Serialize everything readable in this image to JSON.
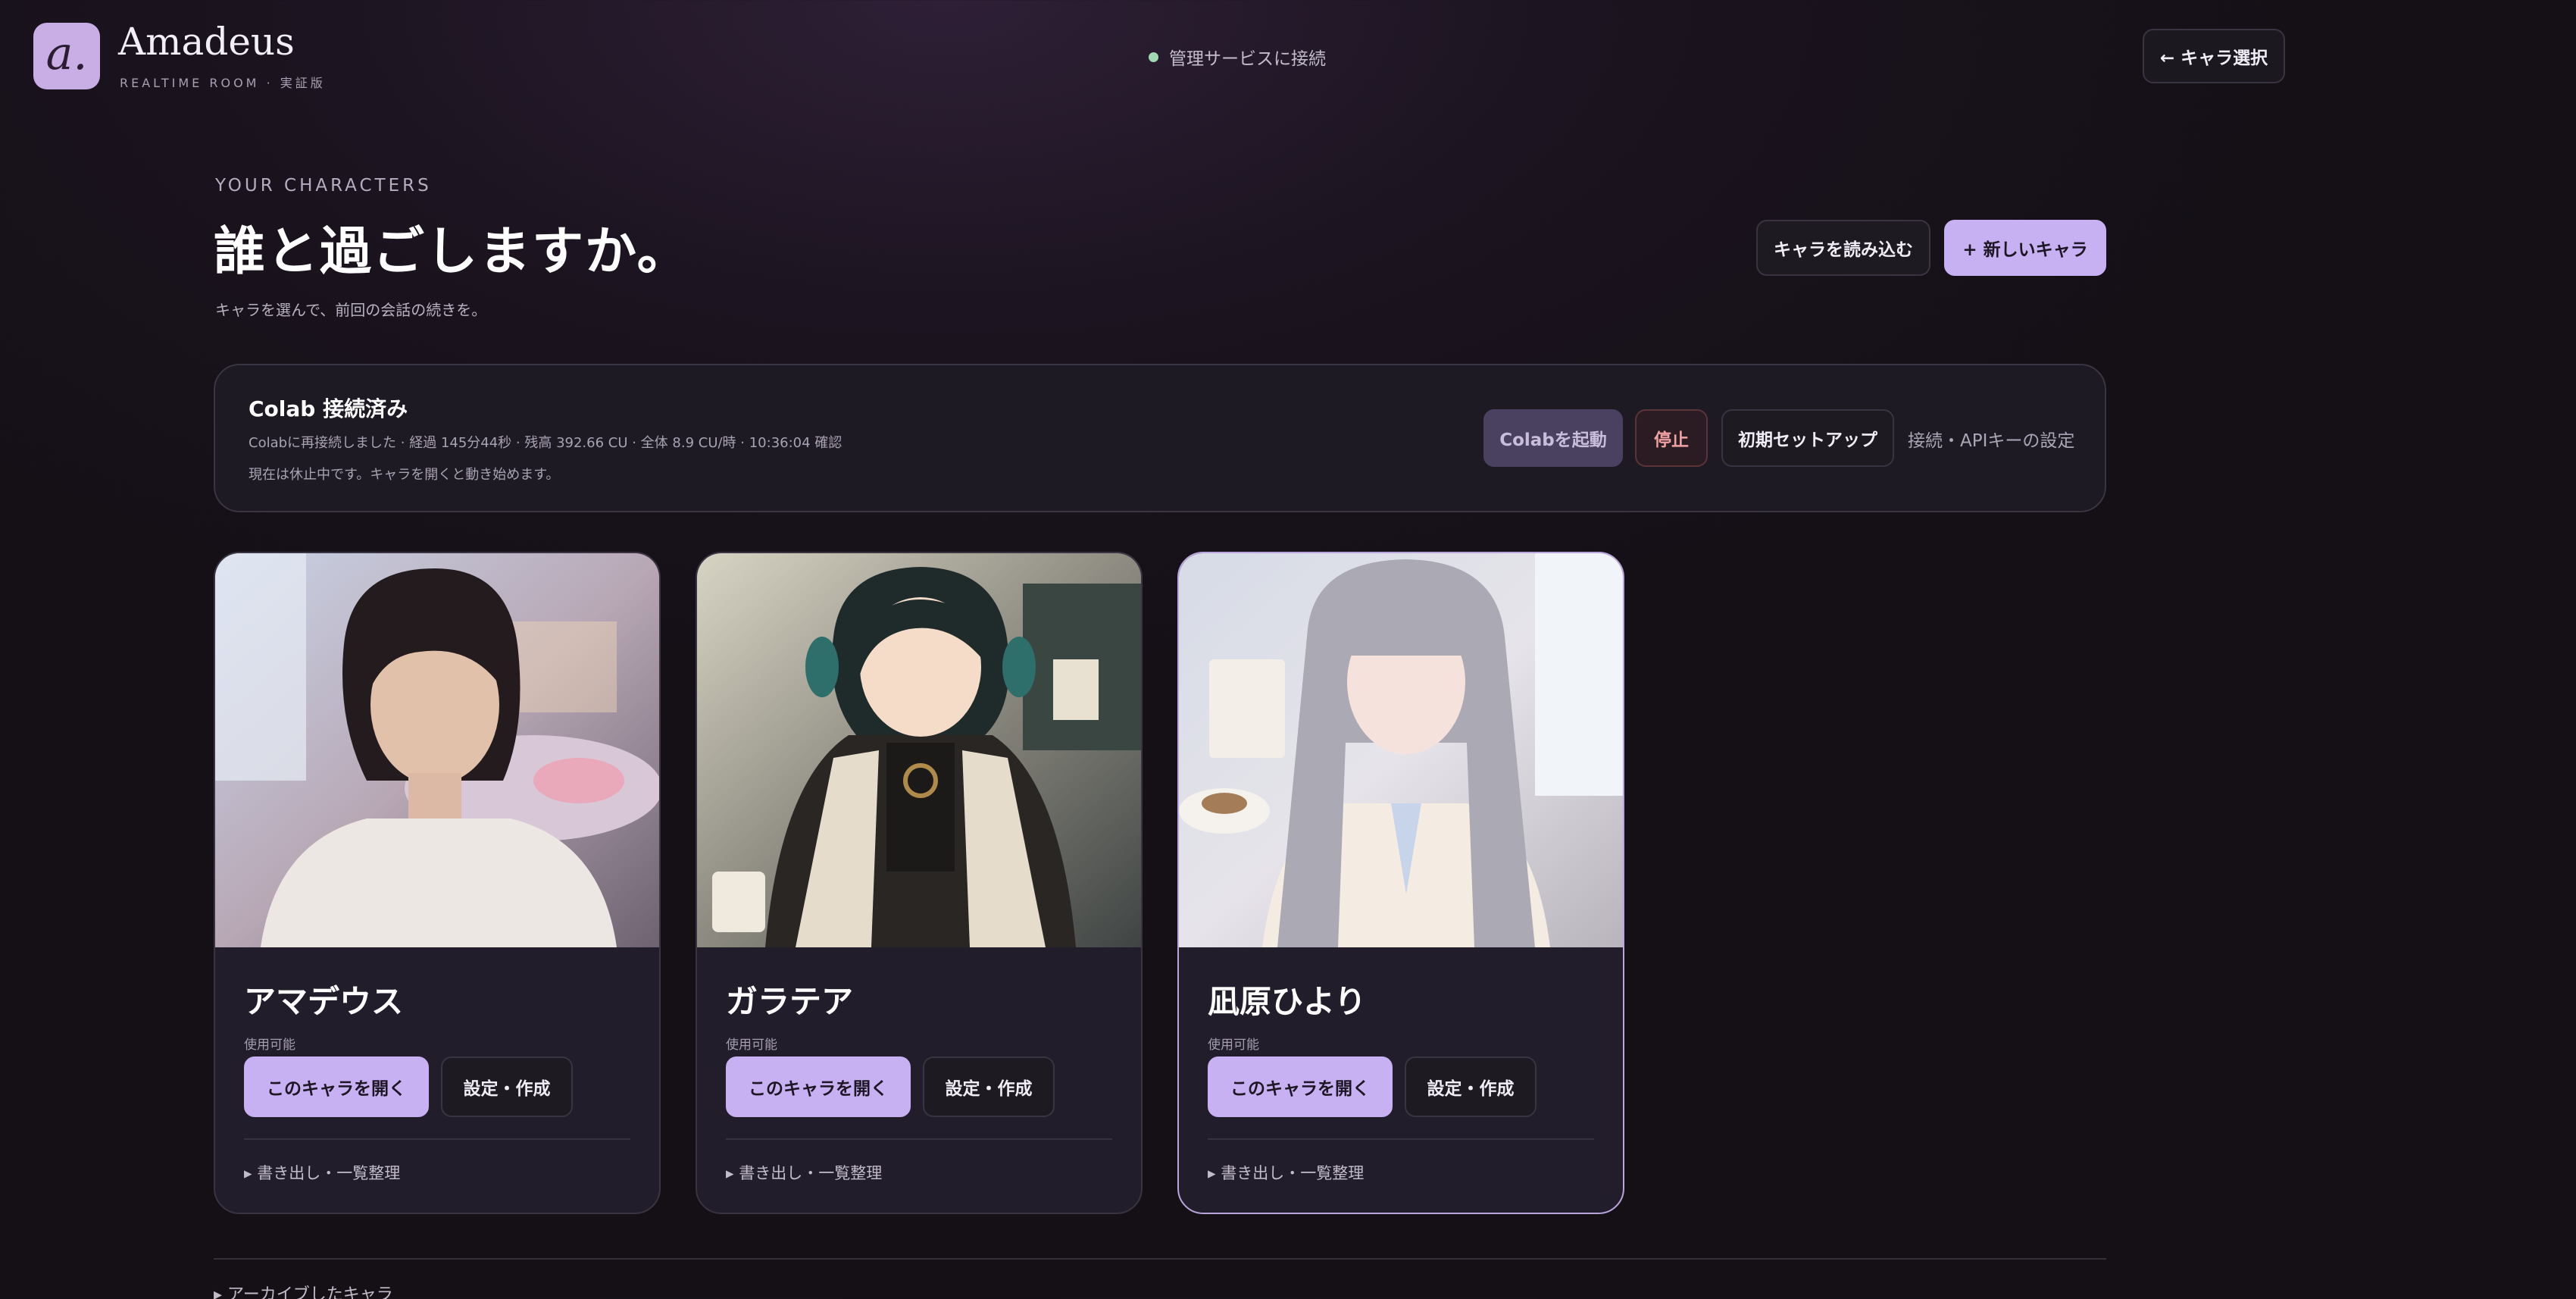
{
  "header": {
    "logo_glyph": "a.",
    "app_title": "Amadeus",
    "app_subtitle": "REALTIME ROOM · 実証版",
    "connection_status": "管理サービスに接続",
    "status_color": "#9fd8b1",
    "back_button": "← キャラ選択"
  },
  "intro": {
    "eyebrow": "YOUR CHARACTERS",
    "headline": "誰と過ごしますか。",
    "subline": "キャラを選んで、前回の会話の続きを。",
    "load_button": "キャラを読み込む",
    "new_button": "+ 新しいキャラ"
  },
  "colab": {
    "title": "Colab 接続済み",
    "detail": "Colabに再接続しました · 経過 145分44秒 · 残高 392.66 CU · 全体 8.9 CU/時 · 10:36:04 確認",
    "note": "現在は休止中です。キャラを開くと動き始めます。",
    "start_button": "Colabを起動",
    "stop_button": "停止",
    "setup_button": "初期セットアップ",
    "api_link": "接続・APIキーの設定"
  },
  "characters": [
    {
      "name": "アマデウス",
      "status": "使用可能",
      "open_button": "このキャラを開く",
      "settings_button": "設定・作成",
      "export_toggle": "▸ 書き出し・一覧整理"
    },
    {
      "name": "ガラテア",
      "status": "使用可能",
      "open_button": "このキャラを開く",
      "settings_button": "設定・作成",
      "export_toggle": "▸ 書き出し・一覧整理"
    },
    {
      "name": "凪原ひより",
      "status": "使用可能",
      "open_button": "このキャラを開く",
      "settings_button": "設定・作成",
      "export_toggle": "▸ 書き出し・一覧整理"
    }
  ],
  "archived_toggle": "▸ アーカイブしたキャラ",
  "colors": {
    "accent": "#c8b1f2",
    "background": "#1c1420",
    "card_bg": "#221d2a",
    "selected_border": "#b9a4dc",
    "danger": "#f0a2a2"
  }
}
